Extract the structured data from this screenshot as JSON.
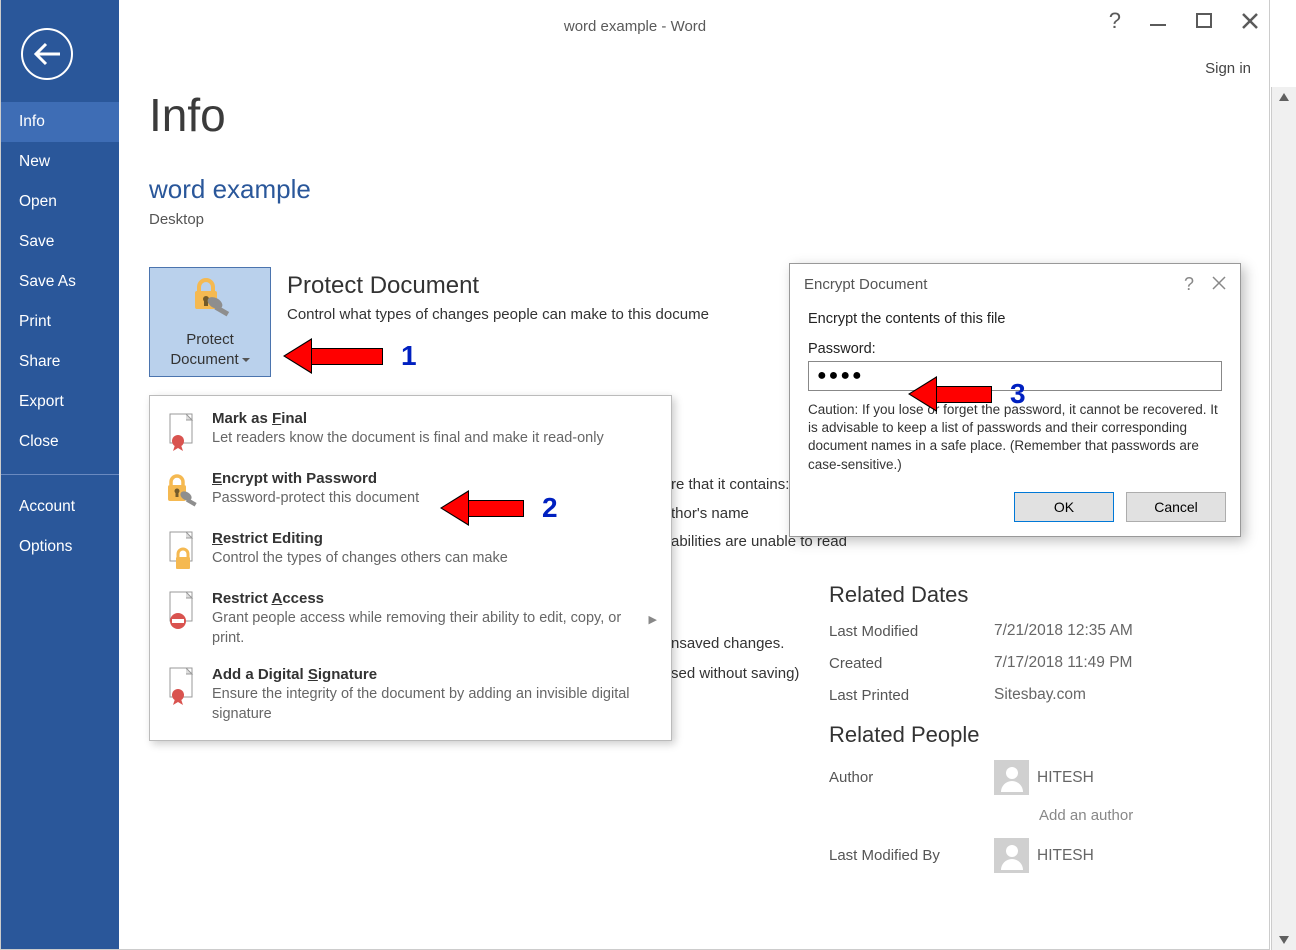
{
  "window": {
    "title": "word example - Word",
    "signin": "Sign in"
  },
  "sidebar": {
    "items": [
      "Info",
      "New",
      "Open",
      "Save",
      "Save As",
      "Print",
      "Share",
      "Export",
      "Close"
    ],
    "bottom": [
      "Account",
      "Options"
    ]
  },
  "page": {
    "title": "Info",
    "doc_name": "word example",
    "doc_location": "Desktop"
  },
  "protect_button": {
    "line1": "Protect",
    "line2": "Document"
  },
  "protect_section": {
    "title": "Protect Document",
    "desc": "Control what types of changes people can make to this docume"
  },
  "dropdown": {
    "items": [
      {
        "title_pre": "Mark as ",
        "title_u": "F",
        "title_post": "inal",
        "desc": "Let readers know the document is final and make it read-only"
      },
      {
        "title_pre": "",
        "title_u": "E",
        "title_post": "ncrypt with Password",
        "desc": "Password-protect this document"
      },
      {
        "title_pre": "",
        "title_u": "R",
        "title_post": "estrict Editing",
        "desc": "Control the types of changes others can make"
      },
      {
        "title_pre": "Restrict ",
        "title_u": "A",
        "title_post": "ccess",
        "desc": "Grant people access while removing their ability to edit, copy, or print.",
        "arrow": true
      },
      {
        "title_pre": "Add a Digital ",
        "title_u": "S",
        "title_post": "ignature",
        "desc": "Ensure the integrity of the document by adding an invisible digital signature"
      }
    ]
  },
  "behind1": {
    "l1": "re that it contains:",
    "l2": "thor's name",
    "l3": "abilities are unable to read"
  },
  "behind2": {
    "l1": "nsaved changes.",
    "l2": "sed without saving)"
  },
  "right_pane": {
    "dates_heading": "Related Dates",
    "rows": [
      {
        "label": "Last Modified",
        "value": "7/21/2018 12:35 AM"
      },
      {
        "label": "Created",
        "value": "7/17/2018 11:49 PM"
      },
      {
        "label": "Last Printed",
        "value": "Sitesbay.com"
      }
    ],
    "people_heading": "Related People",
    "author_label": "Author",
    "author_name": "HITESH",
    "add_author": "Add an author",
    "lastmod_label": "Last Modified By",
    "lastmod_name": "HITESH"
  },
  "dialog": {
    "title": "Encrypt Document",
    "instruction": "Encrypt the contents of this file",
    "pw_label": "Password:",
    "pw_value": "●●●●",
    "caution": "Caution: If you lose or forget the password, it cannot be recovered. It is advisable to keep a list of passwords and their corresponding document names in a safe place. (Remember that passwords are case-sensitive.)",
    "ok": "OK",
    "cancel": "Cancel"
  },
  "annotations": {
    "n1": "1",
    "n2": "2",
    "n3": "3"
  }
}
